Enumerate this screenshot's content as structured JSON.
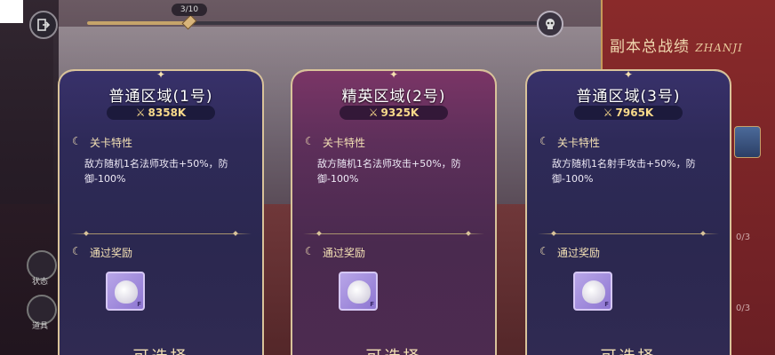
{
  "progress": {
    "label": "3/10",
    "fraction": 0.22
  },
  "side_panel": {
    "title": "副本总战绩",
    "title_en": "ZHANJI",
    "counts": [
      "0/3",
      "0/3"
    ]
  },
  "sidebar": {
    "labels": [
      "状态",
      "道具"
    ]
  },
  "cards": [
    {
      "title": "普通区域(1号)",
      "power": "8358K",
      "trait_title": "关卡特性",
      "trait_desc": "敌方随机1名法师攻击+50%，防御-100%",
      "reward_title": "通过奖励",
      "reward_tag": "F",
      "select_label": "可选择"
    },
    {
      "title": "精英区域(2号)",
      "power": "9325K",
      "trait_title": "关卡特性",
      "trait_desc": "敌方随机1名法师攻击+50%，防御-100%",
      "reward_title": "通过奖励",
      "reward_tag": "F",
      "select_label": "可选择"
    },
    {
      "title": "普通区域(3号)",
      "power": "7965K",
      "trait_title": "关卡特性",
      "trait_desc": "敌方随机1名射手攻击+50%，防御-100%",
      "reward_title": "通过奖励",
      "reward_tag": "F",
      "select_label": "可选择"
    }
  ],
  "icons": {
    "exit": "exit-icon",
    "boss": "skull-icon",
    "swords": "crossed-swords-icon",
    "moon": "crescent-moon-icon",
    "reward": "pouch-icon"
  }
}
